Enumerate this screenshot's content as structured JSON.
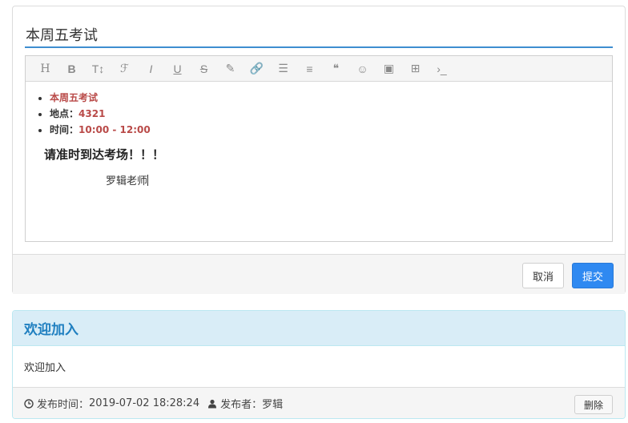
{
  "editor": {
    "title_value": "本周五考试",
    "toolbar": [
      {
        "name": "heading-icon",
        "glyph": "H"
      },
      {
        "name": "bold-icon",
        "glyph": "B"
      },
      {
        "name": "font-size-icon",
        "glyph": "T↕"
      },
      {
        "name": "font-family-icon",
        "glyph": "ℱ"
      },
      {
        "name": "italic-icon",
        "glyph": "I"
      },
      {
        "name": "underline-icon",
        "glyph": "U"
      },
      {
        "name": "strikethrough-icon",
        "glyph": "S"
      },
      {
        "name": "pen-icon",
        "glyph": "✎"
      },
      {
        "name": "link-icon",
        "glyph": "🔗"
      },
      {
        "name": "list-icon",
        "glyph": "☰"
      },
      {
        "name": "align-left-icon",
        "glyph": "≡"
      },
      {
        "name": "quote-icon",
        "glyph": "❝"
      },
      {
        "name": "emoji-icon",
        "glyph": "☺"
      },
      {
        "name": "image-icon",
        "glyph": "▣"
      },
      {
        "name": "table-icon",
        "glyph": "⊞"
      },
      {
        "name": "code-icon",
        "glyph": "›_"
      }
    ],
    "content": {
      "item1": "本周五考试",
      "item2_label": "地点：",
      "item2_value": "4321",
      "item3_label": "时间：",
      "item3_value": "10:00 - 12:00",
      "notice": "请准时到达考场！！！",
      "signature": "罗辑老师"
    },
    "cancel_label": "取消",
    "submit_label": "提交"
  },
  "post": {
    "title": "欢迎加入",
    "body": "欢迎加入",
    "time_label": "发布时间：",
    "time_value": "2019-07-02 18:28:24",
    "author_label": "发布者：",
    "author_value": "罗辑",
    "delete_label": "删除"
  },
  "colors": {
    "accent": "#2f89f1",
    "highlight": "#b94a48",
    "info_header": "#d9edf7",
    "info_text": "#1f7fc0"
  }
}
